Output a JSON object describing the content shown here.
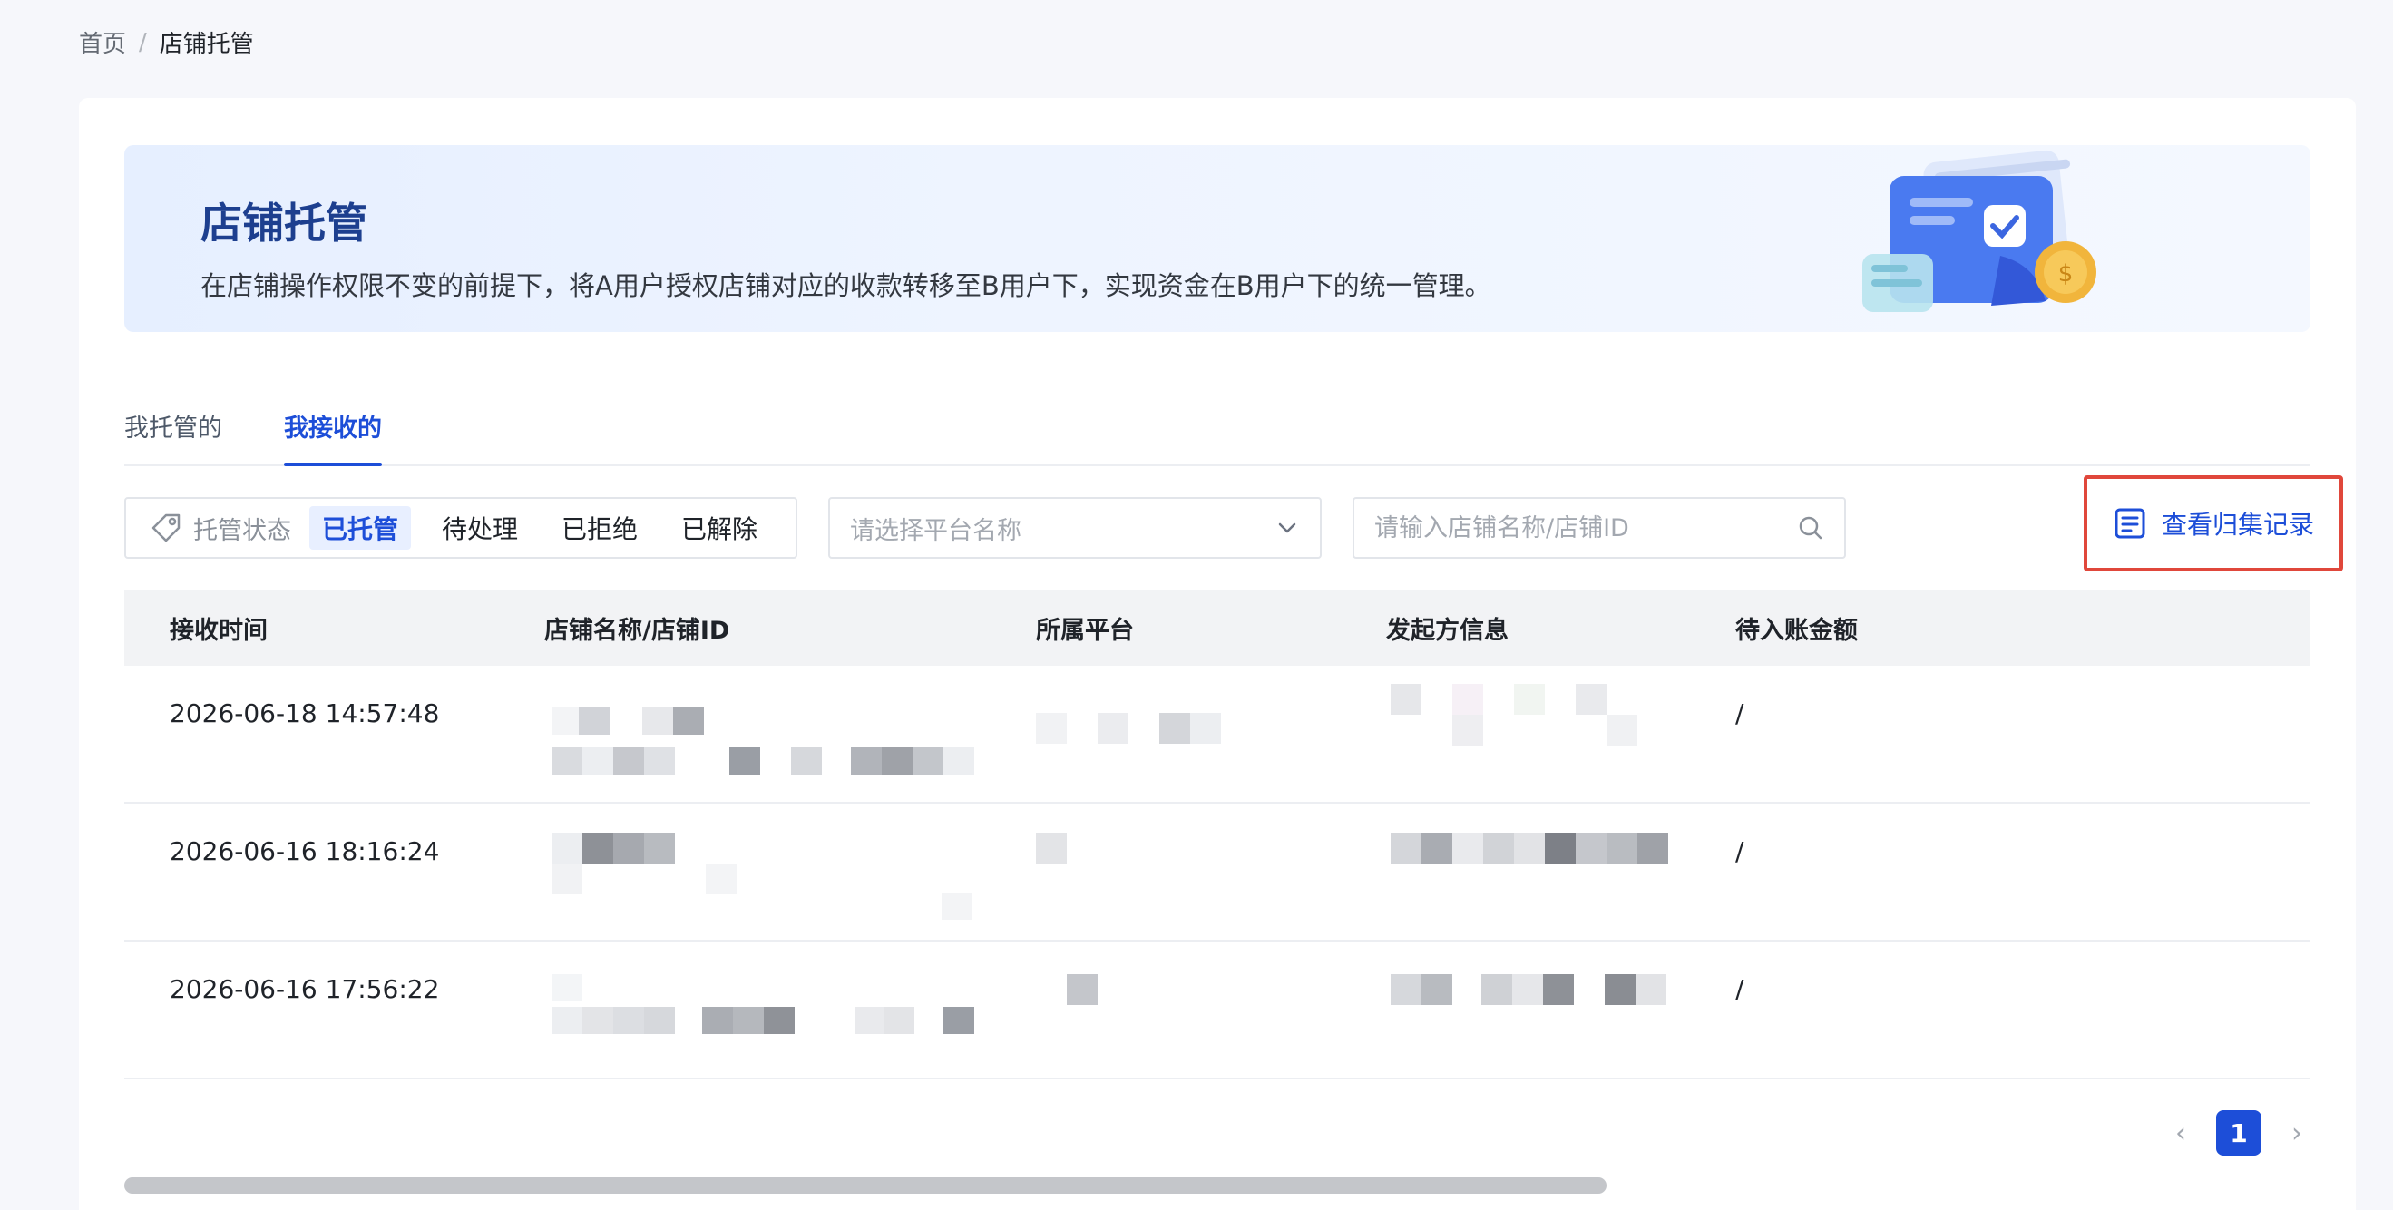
{
  "breadcrumb": {
    "home": "首页",
    "separator": "/",
    "current": "店铺托管"
  },
  "banner": {
    "title": "店铺托管",
    "description": "在店铺操作权限不变的前提下，将A用户授权店铺对应的收款转移至B用户下，实现资金在B用户下的统一管理。"
  },
  "tabs": [
    {
      "label": "我托管的",
      "active": false
    },
    {
      "label": "我接收的",
      "active": true
    }
  ],
  "filters": {
    "status_label": "托管状态",
    "status_options": [
      "已托管",
      "待处理",
      "已拒绝",
      "已解除"
    ],
    "status_selected": "已托管",
    "platform_placeholder": "请选择平台名称",
    "search_placeholder": "请输入店铺名称/店铺ID"
  },
  "records_button": "查看归集记录",
  "table": {
    "columns": [
      "接收时间",
      "店铺名称/店铺ID",
      "所属平台",
      "发起方信息",
      "待入账金额"
    ],
    "rows": [
      {
        "time": "2026-06-18 14:57:48",
        "amount": "/"
      },
      {
        "time": "2026-06-16 18:16:24",
        "amount": "/"
      },
      {
        "time": "2026-06-16 17:56:22",
        "amount": "/"
      }
    ]
  },
  "pagination": {
    "current": "1",
    "prev": "‹",
    "next": "›"
  },
  "colors": {
    "primary": "#1d4ed8",
    "highlight_border": "#e0473b",
    "banner_title": "#1d3f8f"
  }
}
